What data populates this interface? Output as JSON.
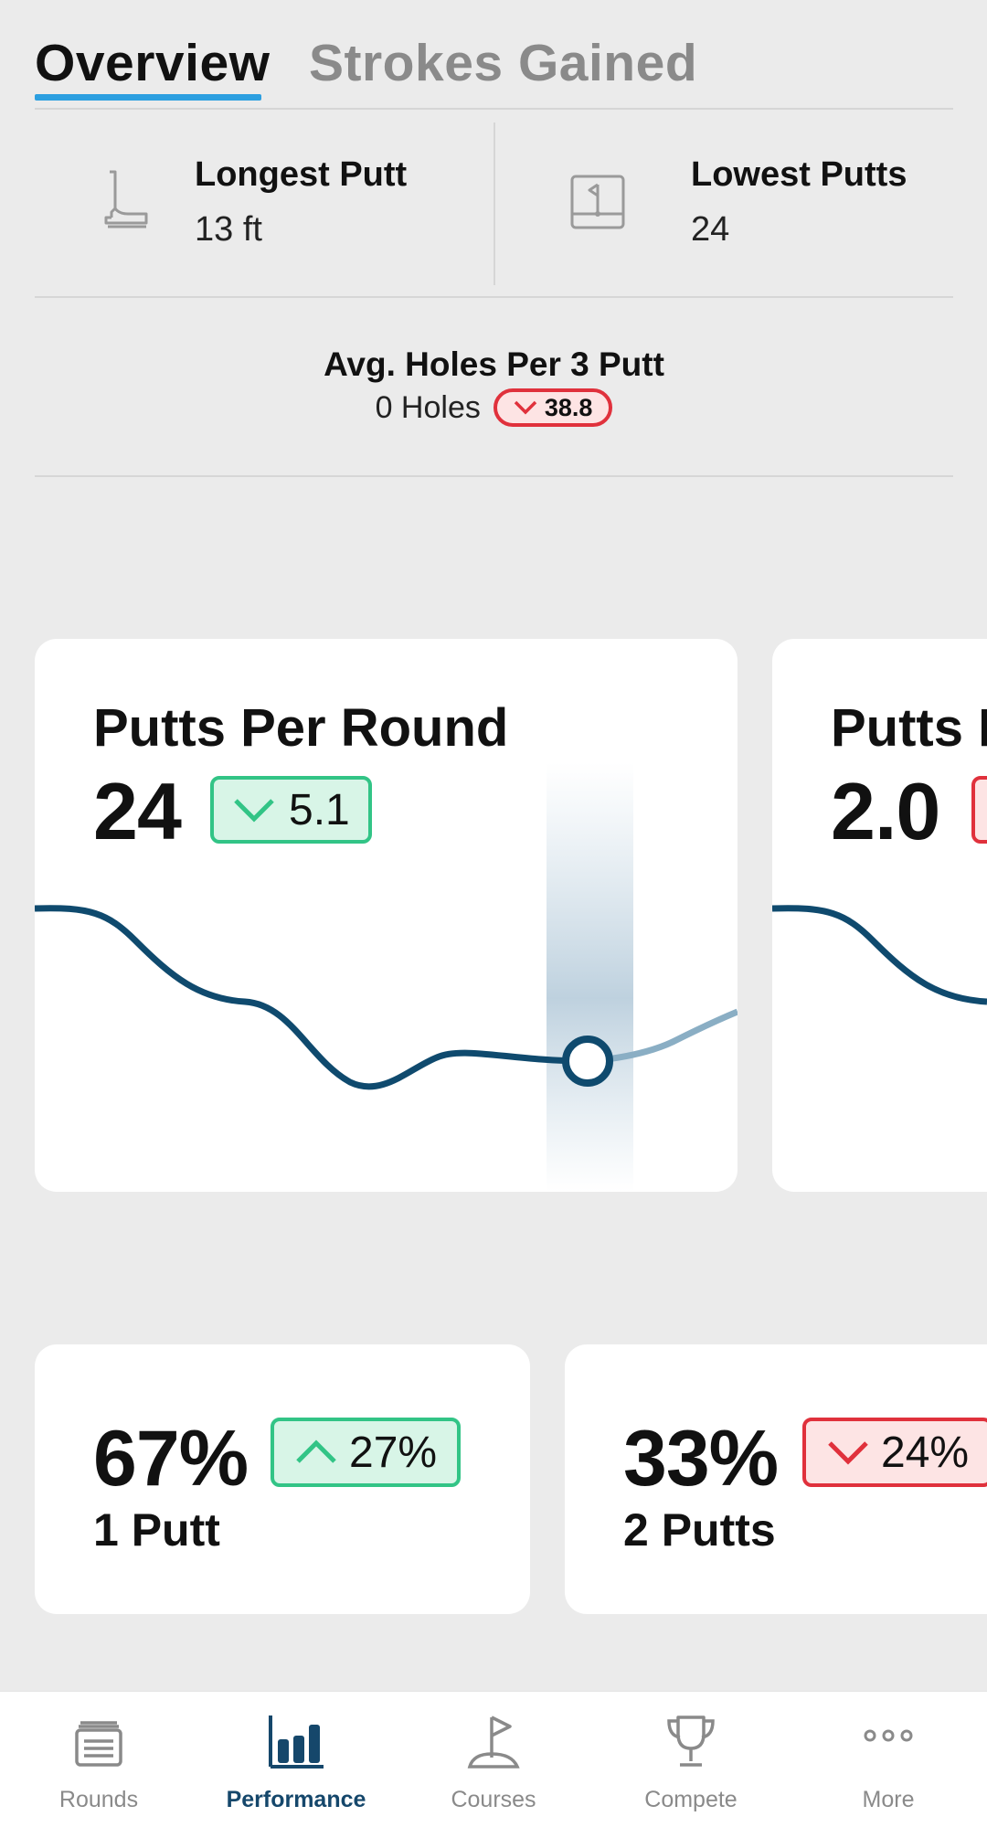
{
  "tabs": [
    {
      "label": "Overview",
      "active": true
    },
    {
      "label": "Strokes Gained",
      "active": false
    }
  ],
  "stats": {
    "longest_putt": {
      "label": "Longest Putt",
      "value": "13 ft",
      "icon": "putter-icon"
    },
    "lowest_putts": {
      "label": "Lowest Putts",
      "value": "24",
      "icon": "flag-scorecard-icon"
    }
  },
  "avg_holes": {
    "title": "Avg. Holes Per 3 Putt",
    "value": "0 Holes",
    "change": "38.8",
    "change_direction": "down",
    "change_color": "#e0313c"
  },
  "chart_cards": [
    {
      "title": "Putts Per Round",
      "value": "24",
      "change": "5.1",
      "change_direction": "down",
      "change_color": "#32c486"
    },
    {
      "title": "Putts P",
      "value": "2.0",
      "change": "",
      "change_direction": "down",
      "change_color": "#e0313c"
    }
  ],
  "putt_cards": [
    {
      "percent": "67%",
      "change": "27%",
      "change_direction": "up",
      "change_color": "#32c486",
      "label": "1 Putt"
    },
    {
      "percent": "33%",
      "change": "24%",
      "change_direction": "down",
      "change_color": "#e0313c",
      "label": "2 Putts"
    }
  ],
  "nav": [
    {
      "label": "Rounds",
      "icon": "rounds-stack-icon",
      "active": false
    },
    {
      "label": "Performance",
      "icon": "bar-chart-icon",
      "active": true
    },
    {
      "label": "Courses",
      "icon": "golf-flag-icon",
      "active": false
    },
    {
      "label": "Compete",
      "icon": "trophy-icon",
      "active": false
    },
    {
      "label": "More",
      "icon": "more-dots-icon",
      "active": false
    }
  ],
  "colors": {
    "accent_tab": "#2c9fe0",
    "line": "#0f4a6e",
    "nav_active": "#15476b",
    "background": "#ebebeb"
  }
}
